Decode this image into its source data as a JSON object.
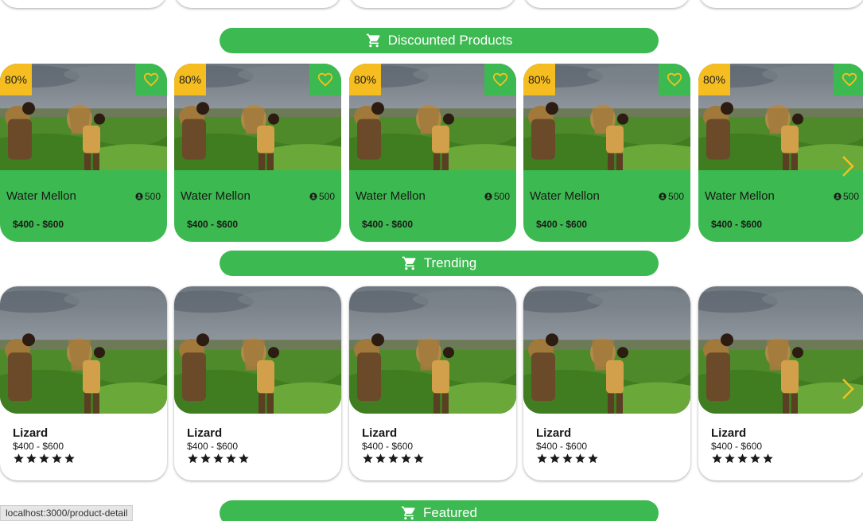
{
  "sections": {
    "discounted": "Discounted Products",
    "trending": "Trending",
    "featured": "Featured"
  },
  "discounted_products": [
    {
      "discount": "80%",
      "name": "Water Mellon",
      "count": "500",
      "price": "$400 - $600"
    },
    {
      "discount": "80%",
      "name": "Water Mellon",
      "count": "500",
      "price": "$400 - $600"
    },
    {
      "discount": "80%",
      "name": "Water Mellon",
      "count": "500",
      "price": "$400 - $600"
    },
    {
      "discount": "80%",
      "name": "Water Mellon",
      "count": "500",
      "price": "$400 - $600"
    },
    {
      "discount": "80%",
      "name": "Water Mellon",
      "count": "500",
      "price": "$400 - $600"
    }
  ],
  "trending_products": [
    {
      "name": "Lizard",
      "price": "$400 - $600",
      "rating": 5
    },
    {
      "name": "Lizard",
      "price": "$400 - $600",
      "rating": 5
    },
    {
      "name": "Lizard",
      "price": "$400 - $600",
      "rating": 5
    },
    {
      "name": "Lizard",
      "price": "$400 - $600",
      "rating": 5
    },
    {
      "name": "Lizard",
      "price": "$400 - $600",
      "rating": 5
    }
  ],
  "status_bar": "localhost:3000/product-detail",
  "colors": {
    "brand_green": "#3cb950",
    "badge_yellow": "#f5bd1f",
    "arrow_yellow": "#f2c21c"
  },
  "icons": {
    "banner": "cart-icon",
    "favorite": "heart-outline-icon",
    "count": "person-icon",
    "rating": "star-icon",
    "carousel": "chevron-right-icon"
  }
}
